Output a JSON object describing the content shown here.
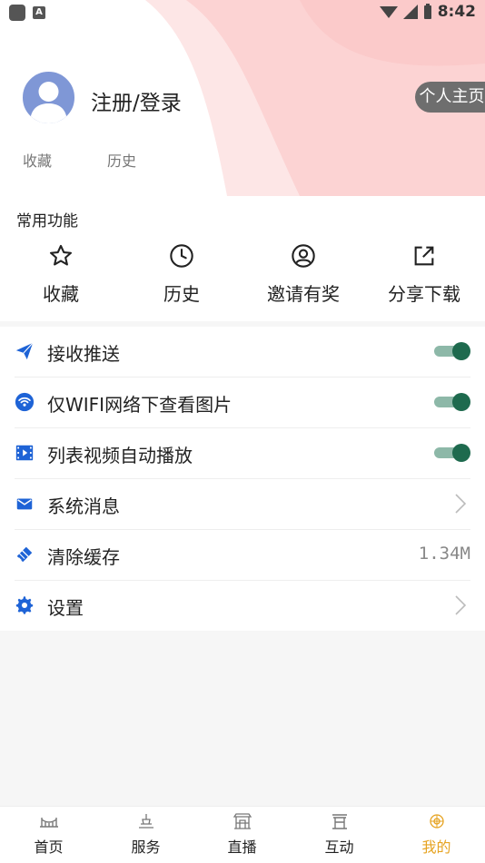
{
  "status_bar": {
    "time": "8:42"
  },
  "header": {
    "login_text": "注册/登录",
    "profile_button": "个人主页",
    "links": [
      "收藏",
      "历史"
    ]
  },
  "common_functions": {
    "title": "常用功能",
    "items": [
      {
        "label": "收藏",
        "icon": "star-icon"
      },
      {
        "label": "历史",
        "icon": "clock-icon"
      },
      {
        "label": "邀请有奖",
        "icon": "user-circle-icon"
      },
      {
        "label": "分享下载",
        "icon": "share-icon"
      }
    ]
  },
  "settings": {
    "push": {
      "label": "接收推送",
      "icon": "send-icon",
      "enabled": true
    },
    "wifi_images": {
      "label": "仅WIFI网络下查看图片",
      "icon": "wifi-icon",
      "enabled": true
    },
    "autoplay": {
      "label": "列表视频自动播放",
      "icon": "video-icon",
      "enabled": true
    },
    "messages": {
      "label": "系统消息",
      "icon": "mail-icon"
    },
    "clear_cache": {
      "label": "清除缓存",
      "icon": "broom-icon",
      "value": "1.34M"
    },
    "settings": {
      "label": "设置",
      "icon": "gear-icon"
    }
  },
  "tabbar": {
    "items": [
      {
        "label": "首页",
        "icon": "home-bridge-icon"
      },
      {
        "label": "服务",
        "icon": "service-icon"
      },
      {
        "label": "直播",
        "icon": "live-icon"
      },
      {
        "label": "互动",
        "icon": "interact-icon"
      },
      {
        "label": "我的",
        "icon": "mine-icon",
        "active": true
      }
    ]
  },
  "colors": {
    "accent_blue": "#1e63d6",
    "toggle_on": "#1e6a4e",
    "active_tab": "#e6a321",
    "header_pink": "#fcd3d3"
  }
}
